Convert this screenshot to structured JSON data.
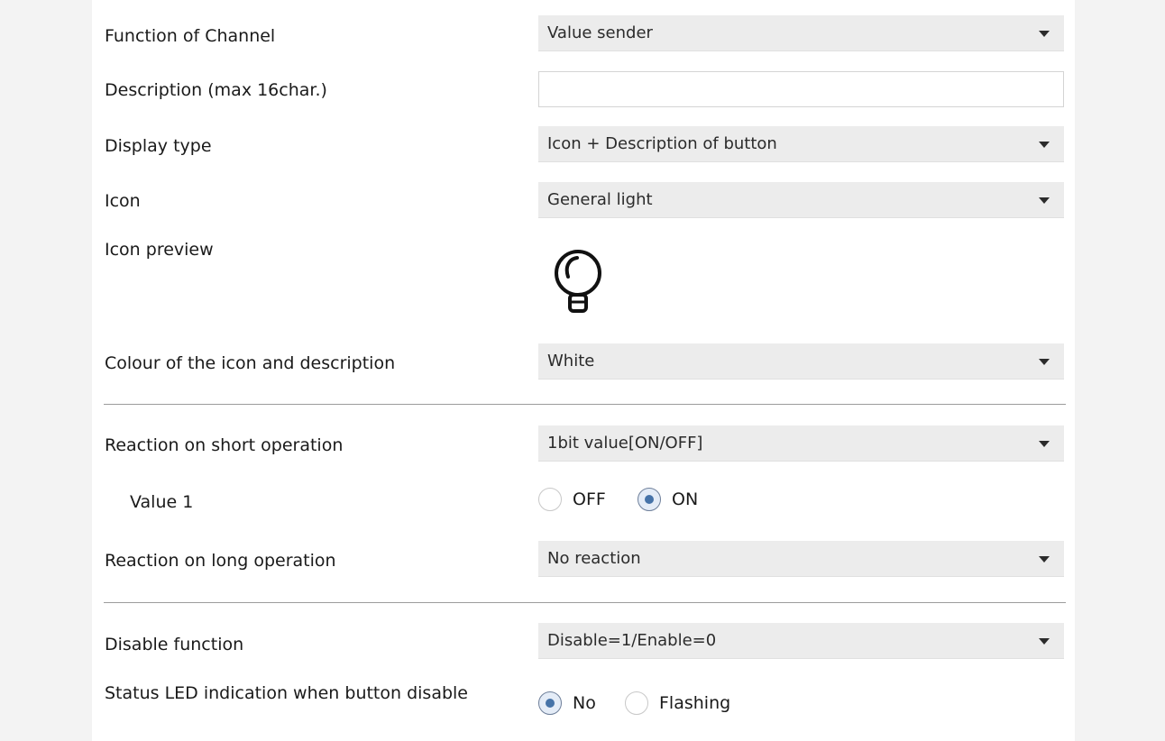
{
  "rows": {
    "function_of_channel": {
      "label": "Function of Channel",
      "value": "Value sender"
    },
    "description": {
      "label": "Description (max 16char.)",
      "value": ""
    },
    "display_type": {
      "label": "Display type",
      "value": "Icon + Description of button"
    },
    "icon": {
      "label": "Icon",
      "value": "General light"
    },
    "icon_preview": {
      "label": "Icon preview",
      "icon_name": "light-bulb-icon"
    },
    "colour": {
      "label": "Colour of the icon and description",
      "value": "White"
    },
    "short_operation": {
      "label": "Reaction on short operation",
      "value": "1bit value[ON/OFF]"
    },
    "value1": {
      "label": "Value 1",
      "options": [
        {
          "label": "OFF",
          "checked": false
        },
        {
          "label": "ON",
          "checked": true
        }
      ]
    },
    "long_operation": {
      "label": "Reaction on long operation",
      "value": "No reaction"
    },
    "disable_function": {
      "label": "Disable function",
      "value": "Disable=1/Enable=0"
    },
    "status_led": {
      "label": " Status LED indication when button disable",
      "options": [
        {
          "label": "No",
          "checked": true
        },
        {
          "label": "Flashing",
          "checked": false
        }
      ]
    }
  },
  "colors": {
    "page_background": "#f3f3f3",
    "panel_background": "#ffffff",
    "dropdown_background": "#ececec",
    "radio_checked": "#4673a8",
    "divider": "#9c9c9c"
  }
}
